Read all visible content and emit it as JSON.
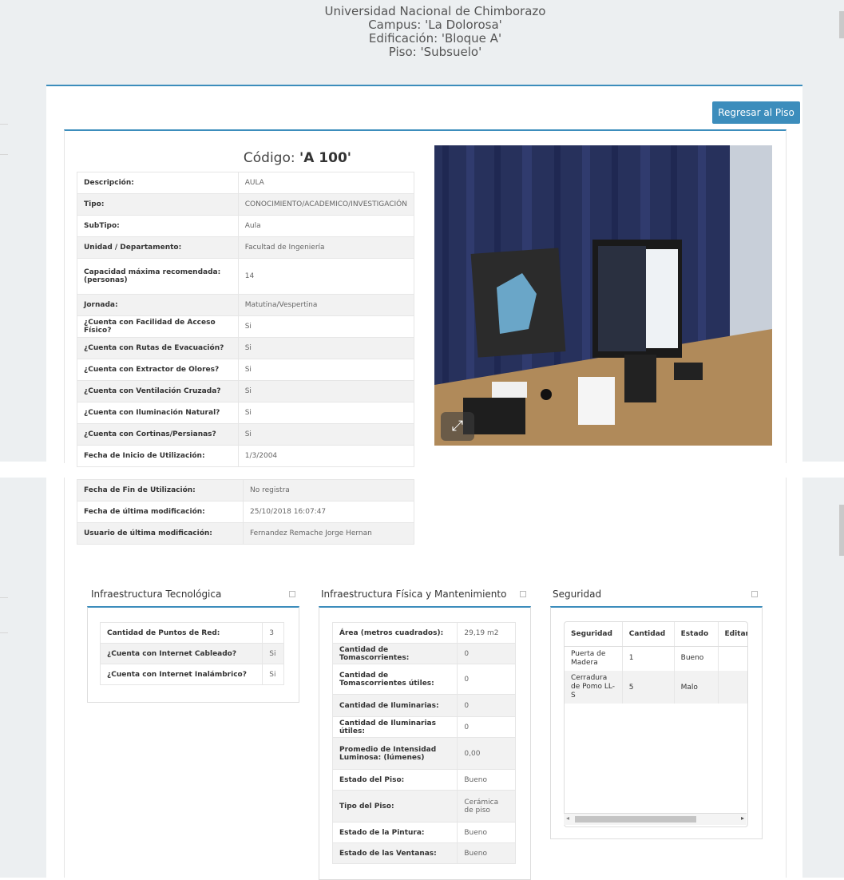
{
  "header": {
    "university": "Universidad Nacional de Chimborazo",
    "campus": "Campus: 'La Dolorosa'",
    "building": "Edificación: 'Bloque A'",
    "floor": "Piso: 'Subsuelo'"
  },
  "back_button": "Regresar al Piso",
  "code": {
    "prefix": "Código:",
    "value": "'A 100'"
  },
  "details": [
    {
      "key": "Descripción:",
      "value": "AULA"
    },
    {
      "key": "Tipo:",
      "value": "CONOCIMIENTO/ACADEMICO/INVESTIGACIÓN"
    },
    {
      "key": "SubTipo:",
      "value": "Aula"
    },
    {
      "key": "Unidad / Departamento:",
      "value": "Facultad de Ingeniería"
    },
    {
      "key": "Capacidad máxima recomendada: (personas)",
      "value": "14"
    },
    {
      "key": "Jornada:",
      "value": "Matutina/Vespertina"
    },
    {
      "key": "¿Cuenta con Facilidad de Acceso Físico?",
      "value": "Si"
    },
    {
      "key": "¿Cuenta con Rutas de Evacuación?",
      "value": "Si"
    },
    {
      "key": "¿Cuenta con Extractor de Olores?",
      "value": "Si"
    },
    {
      "key": "¿Cuenta con Ventilación Cruzada?",
      "value": "Si"
    },
    {
      "key": "¿Cuenta con Iluminación Natural?",
      "value": "Si"
    },
    {
      "key": "¿Cuenta con Cortinas/Persianas?",
      "value": "Si"
    },
    {
      "key": "Fecha de Inicio de Utilización:",
      "value": "1/3/2004"
    },
    {
      "key": "Fecha de Fin de Utilización:",
      "value": "No registra"
    },
    {
      "key": "Fecha de última modificación:",
      "value": "25/10/2018 16:07:47"
    },
    {
      "key": "Usuario de última modificación:",
      "value": "Fernandez Remache Jorge Hernan"
    }
  ],
  "tech": {
    "title": "Infraestructura Tecnológica",
    "rows": [
      {
        "key": "Cantidad de Puntos de Red:",
        "value": "3"
      },
      {
        "key": "¿Cuenta con Internet Cableado?",
        "value": "Si"
      },
      {
        "key": "¿Cuenta con Internet Inalámbrico?",
        "value": "Si"
      }
    ]
  },
  "physical": {
    "title": "Infraestructura Física y Mantenimiento",
    "rows": [
      {
        "key": "Área (metros cuadrados):",
        "value": "29,19 m2"
      },
      {
        "key": "Cantidad de Tomascorrientes:",
        "value": "0"
      },
      {
        "key": "Cantidad de Tomascorrientes útiles:",
        "value": "0"
      },
      {
        "key": "Cantidad de Iluminarias:",
        "value": "0"
      },
      {
        "key": "Cantidad de Iluminarias útiles:",
        "value": "0"
      },
      {
        "key": "Promedio de Intensidad Luminosa: (lúmenes)",
        "value": "0,00"
      },
      {
        "key": "Estado del Piso:",
        "value": "Bueno"
      },
      {
        "key": "Tipo del Piso:",
        "value": "Cerámica de piso"
      },
      {
        "key": "Estado de la Pintura:",
        "value": "Bueno"
      },
      {
        "key": "Estado de las Ventanas:",
        "value": "Bueno"
      }
    ]
  },
  "security": {
    "title": "Seguridad",
    "columns": [
      "Seguridad",
      "Cantidad",
      "Estado",
      "Editar"
    ],
    "rows": [
      {
        "item": "Puerta de Madera",
        "qty": "1",
        "state": "Bueno"
      },
      {
        "item": "Cerradura de Pomo LL-S",
        "qty": "5",
        "state": "Malo"
      }
    ]
  },
  "icons": {
    "expand": "expand-icon",
    "box_toggle": "box-toggle-icon",
    "scroll_left": "arrow-left-icon",
    "scroll_right": "arrow-right-icon"
  },
  "colors": {
    "accent": "#3c8dbc",
    "band": "#eceff1",
    "alt_row": "#f2f2f2"
  }
}
